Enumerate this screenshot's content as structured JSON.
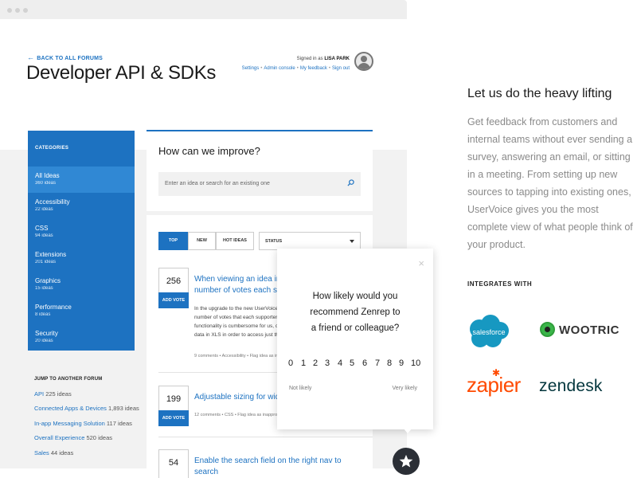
{
  "forum": {
    "back_link": "BACK TO ALL FORUMS",
    "title": "Developer API & SDKs",
    "signed_in_prefix": "Signed in as",
    "user_name": "LISA PARK",
    "user_links": [
      "Settings",
      "Admin console",
      "My feedback",
      "Sign out"
    ]
  },
  "sidebar": {
    "categories_title": "CATEGORIES",
    "categories": [
      {
        "name": "All Ideas",
        "count": "360 ideas"
      },
      {
        "name": "Accessibility",
        "count": "22 ideas"
      },
      {
        "name": "CSS",
        "count": "94 ideas"
      },
      {
        "name": "Extensions",
        "count": "201 ideas"
      },
      {
        "name": "Graphics",
        "count": "15 ideas"
      },
      {
        "name": "Performance",
        "count": "8 ideas"
      },
      {
        "name": "Security",
        "count": "20 ideas"
      }
    ],
    "jump_title": "JUMP TO ANOTHER FORUM",
    "forums": [
      {
        "name": "API",
        "count": "225 ideas"
      },
      {
        "name": "Connected Apps & Devices",
        "count": "1,893 ideas"
      },
      {
        "name": "In-app Messaging Solution",
        "count": "117 ideas"
      },
      {
        "name": "Overall Experience",
        "count": "520 ideas"
      },
      {
        "name": "Sales",
        "count": "44 ideas"
      }
    ]
  },
  "main": {
    "improve_heading": "How can we improve?",
    "search_placeholder": "Enter an idea or search for an existing one",
    "filters": [
      "TOP",
      "NEW",
      "HOT IDEAS"
    ],
    "status_label": "STATUS",
    "vote_label": "ADD VOTE",
    "ideas": [
      {
        "votes": "256",
        "title_l1": "When viewing an idea in A",
        "title_l2": "number of votes each suppor",
        "body": [
          "In the upgrade to the new UserVoice s",
          "number of votes that each supporter",
          "functionality is cumbersome for us, ca",
          "data in XLS in order to access just this"
        ],
        "meta": "9 comments  •  Accessibility  •  Flag idea as inap"
      },
      {
        "votes": "199",
        "title_l1": "Adjustable sizing for widge",
        "meta": "12 comments  •  CSS  •  Flag idea as inappro"
      },
      {
        "votes": "54",
        "title_l1": "Enable the search field on the right nav to search"
      }
    ]
  },
  "nps": {
    "close": "×",
    "question_l1": "How likely would you",
    "question_l2": "recommend Zenrep to",
    "question_l3": "a friend or colleague?",
    "scores": [
      "0",
      "1",
      "2",
      "3",
      "4",
      "5",
      "6",
      "7",
      "8",
      "9",
      "10"
    ],
    "low_label": "Not likely",
    "high_label": "Very likely"
  },
  "marketing": {
    "title": "Let us do the heavy lifting",
    "body": "Get feedback from customers and internal teams without ever sending a survey, answering an email, or sitting in a meeting. From setting up new sources to tapping into existing ones, UserVoice gives you the most complete view of what people think of your product.",
    "integrates_title": "INTEGRATES WITH",
    "logos": {
      "salesforce": "salesforce",
      "wootric": "WOOTRIC",
      "zapier": "zapier",
      "zendesk": "zendesk"
    }
  },
  "colors": {
    "accent": "#1d72c1",
    "active_category": "#3088d4",
    "zapier": "#ff4a00",
    "salesforce": "#1798c1",
    "wootric": "#3bb54a",
    "zendesk": "#03363d"
  },
  "icons": [
    "back-arrow-icon",
    "avatar-icon",
    "search-icon",
    "caret-down-icon",
    "close-icon",
    "star-icon"
  ]
}
